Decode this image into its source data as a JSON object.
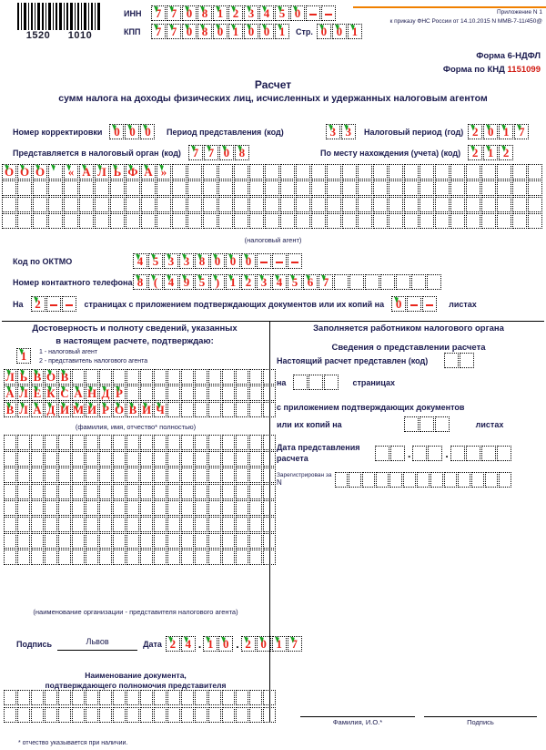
{
  "header": {
    "barcode": {
      "left": "1520",
      "right": "1010"
    },
    "inn_label": "ИНН",
    "inn_value": "7708123450--",
    "kpp_label": "КПП",
    "kpp_value": "770801001",
    "page_label": "Стр.",
    "page_value": "001",
    "appendix_line1": "Приложение N 1",
    "appendix_line2": "к приказу ФНС России от 14.10.2015 N ММВ-7-11/450@",
    "form_label": "Форма 6-НДФЛ",
    "knd_label": "Форма по КНД",
    "knd_value": "1151099"
  },
  "title": {
    "line1": "Расчет",
    "line2": "сумм налога на доходы физических лиц, исчисленных и удержанных налоговым агентом"
  },
  "fields": {
    "correction_label": "Номер корректировки",
    "correction_value": "000",
    "period_label": "Период представления",
    "period_label_code": "(код)",
    "period_value": "33",
    "taxyear_label": "Налоговый период",
    "taxyear_label_code": "(год)",
    "taxyear_value": "2017",
    "taxorgan_label": "Представляется в налоговый орган",
    "taxorgan_label_code": "(код)",
    "taxorgan_value": "7708",
    "location_label": "По месту нахождения (учета) (код)",
    "location_value": "212",
    "agent_name_row1": "ООО «АЛЬФА»",
    "agent_caption": "(налоговый агент)",
    "oktmo_label": "Код по ОКТМО",
    "oktmo_value": "45338000---",
    "phone_label": "Номер контактного телефона",
    "phone_value": "8(495)1234567",
    "pages_prefix": "На",
    "pages_value": "2--",
    "pages_mid": "страницах с приложением подтверждающих документов или их копий на",
    "sheets_value": "0--",
    "pages_suffix": "листах"
  },
  "left_panel": {
    "heading1": "Достоверность и полноту сведений, указанных",
    "heading2": "в настоящем расчете, подтверждаю:",
    "confirm_code": "1",
    "legend1": "1 - налоговый агент",
    "legend2": "2 - представитель налогового агента",
    "surname": "ЛЬВОВ",
    "firstname": "АЛЕКСАНДР",
    "patronymic": "ВЛАДИМИРОВИЧ",
    "fio_caption": "(фамилия, имя, отчество* полностью)",
    "org_caption": "(наименование организации - представителя налогового агента)",
    "sign_label": "Подпись",
    "sign_value": "Львов",
    "date_label": "Дата",
    "date_day": "24",
    "date_month": "10",
    "date_year": "2017",
    "doc_caption1": "Наименование документа,",
    "doc_caption2": "подтверждающего полномочия представителя"
  },
  "right_panel": {
    "heading": "Заполняется работником налогового органа",
    "subheading": "Сведения о представлении расчета",
    "submitted_label": "Настоящий расчет представлен (код)",
    "pages_prefix": "на",
    "pages_suffix": "страницах",
    "attach_line1": "с приложением подтверждающих документов",
    "attach_line2": "или их копий на",
    "attach_suffix": "листах",
    "date_label1": "Дата представления",
    "date_label2": "расчета",
    "registered_label1": "Зарегистрирован за",
    "registered_label2": "N",
    "footer_fio": "Фамилия, И.О.*",
    "footer_sign": "Подпись"
  },
  "footnote": "* отчество указывается при наличии.",
  "colors": {
    "ink": "#e8251b",
    "label": "#1a1a4e",
    "tick": "#16a020",
    "rule": "#f08000"
  }
}
